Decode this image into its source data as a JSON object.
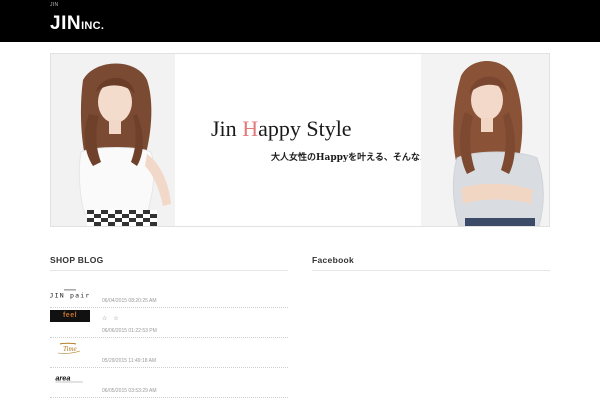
{
  "header": {
    "tiny_text": "JIN",
    "logo_main": "JIN",
    "logo_sub": "INC."
  },
  "banner": {
    "title_pre": "Jin ",
    "title_h": "H",
    "title_post": "appy Style",
    "subtitle": "大人女性のHappyを叶える、そんなスタイル",
    "accent_color": "#e27a7a"
  },
  "shop_blog": {
    "heading": "SHOP BLOG",
    "items": [
      {
        "brand": "jin pair",
        "text": "",
        "date": "06/04/2015 08:20:25 AM"
      },
      {
        "brand": "feel",
        "text": "☆　☆",
        "date": "06/06/2015 01:22:53 PM"
      },
      {
        "brand": "Time",
        "text": "",
        "date": "05/29/2015 11:49:18 AM"
      },
      {
        "brand": "area",
        "text": "",
        "date": "06/05/2015 03:53:29 AM"
      }
    ]
  },
  "facebook": {
    "heading": "Facebook"
  }
}
